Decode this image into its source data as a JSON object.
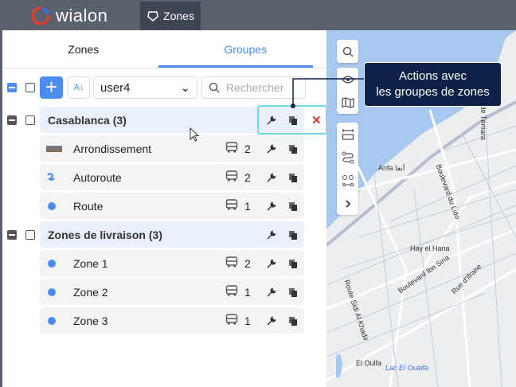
{
  "header": {
    "logo_text": "wialon",
    "app_tab": "Zones"
  },
  "tabs": [
    {
      "label": "Zones"
    },
    {
      "label": "Groupes"
    }
  ],
  "toolbar": {
    "add_label": "+",
    "sort_label": "A↓",
    "user_select": "user4",
    "search_placeholder": "Rechercher"
  },
  "groups": [
    {
      "name": "Casablanca (3)",
      "zones": [
        {
          "name": "Arrondissement",
          "icon": "image-thumbnail",
          "units": "2"
        },
        {
          "name": "Autoroute",
          "icon": "line-zone",
          "units": "2"
        },
        {
          "name": "Route",
          "icon": "circle-zone",
          "units": "1"
        }
      ]
    },
    {
      "name": "Zones de livraison (3)",
      "zones": [
        {
          "name": "Zone 1",
          "icon": "circle-zone",
          "units": "2"
        },
        {
          "name": "Zone 2",
          "icon": "circle-zone",
          "units": "1"
        },
        {
          "name": "Zone 3",
          "icon": "circle-zone",
          "units": "1"
        }
      ]
    }
  ],
  "tooltip": {
    "line1": "Actions avec",
    "line2": "les groupes de zones"
  },
  "map_labels": {
    "temara": "ue de Témara",
    "anfa": "Anfa أنفا",
    "lido": "Boulevard du Lido",
    "hana": "Hay el Hana",
    "ibnsina": "Boulevard Ibn Sina",
    "ifrane": "Rue d'Ifrane",
    "sidi": "Route Sidi Al Khadir",
    "oulfa": "El Oulfa",
    "lac": "Lac El Oualfa"
  },
  "colors": {
    "accent": "#4a8cf0",
    "topbar": "#5b616d",
    "tooltip": "#0e2249",
    "delete": "#e53935"
  }
}
